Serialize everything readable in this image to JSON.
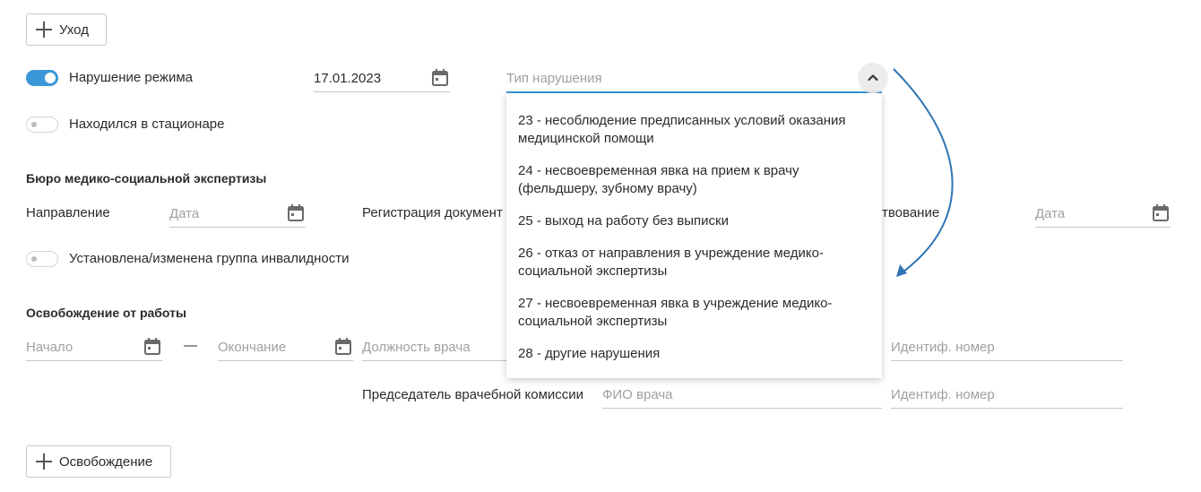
{
  "buttons": {
    "care_label": "Уход",
    "release_label": "Освобождение"
  },
  "violation": {
    "toggle_label": "Нарушение режима",
    "toggle_on": true,
    "date_value": "17.01.2023",
    "type_placeholder": "Тип нарушения"
  },
  "hospital": {
    "toggle_label": "Находился в стационаре",
    "toggle_on": false
  },
  "bureau": {
    "heading": "Бюро медико-социальной экспертизы",
    "direction_label": "Направление",
    "direction_placeholder": "Дата",
    "registration_label": "Регистрация документ",
    "exam_label_fragment": "твование",
    "exam_placeholder": "Дата",
    "disability_toggle_label": "Установлена/изменена группа инвалидности",
    "disability_toggle_on": false
  },
  "release": {
    "heading": "Освобождение от работы",
    "start_placeholder": "Начало",
    "dash": "—",
    "end_placeholder": "Окончание",
    "position_placeholder": "Должность врача",
    "id_placeholder_1": "Идентиф. номер",
    "chairman_label": "Председатель врачебной комиссии",
    "doctor_name_placeholder": "ФИО врача",
    "id_placeholder_2": "Идентиф. номер"
  },
  "dropdown": {
    "options": [
      "23 - несоблюдение предписанных условий оказания медицинской помощи",
      "24 - несвоевременная явка на прием к врачу (фельдшеру, зубному врачу)",
      "25 - выход на работу без выписки",
      "26 - отказ от направления в учреждение медико-социальной экспертизы",
      "27 - несвоевременная явка в учреждение медико-социальной экспертизы",
      "28 - другие нарушения"
    ]
  },
  "colors": {
    "accent": "#3a98d8",
    "arrow": "#2f74b5"
  },
  "icons": {
    "plus": "plus-icon",
    "calendar": "calendar-icon",
    "chevron": "chevron-up-icon",
    "arrow": "curved-arrow-icon"
  }
}
